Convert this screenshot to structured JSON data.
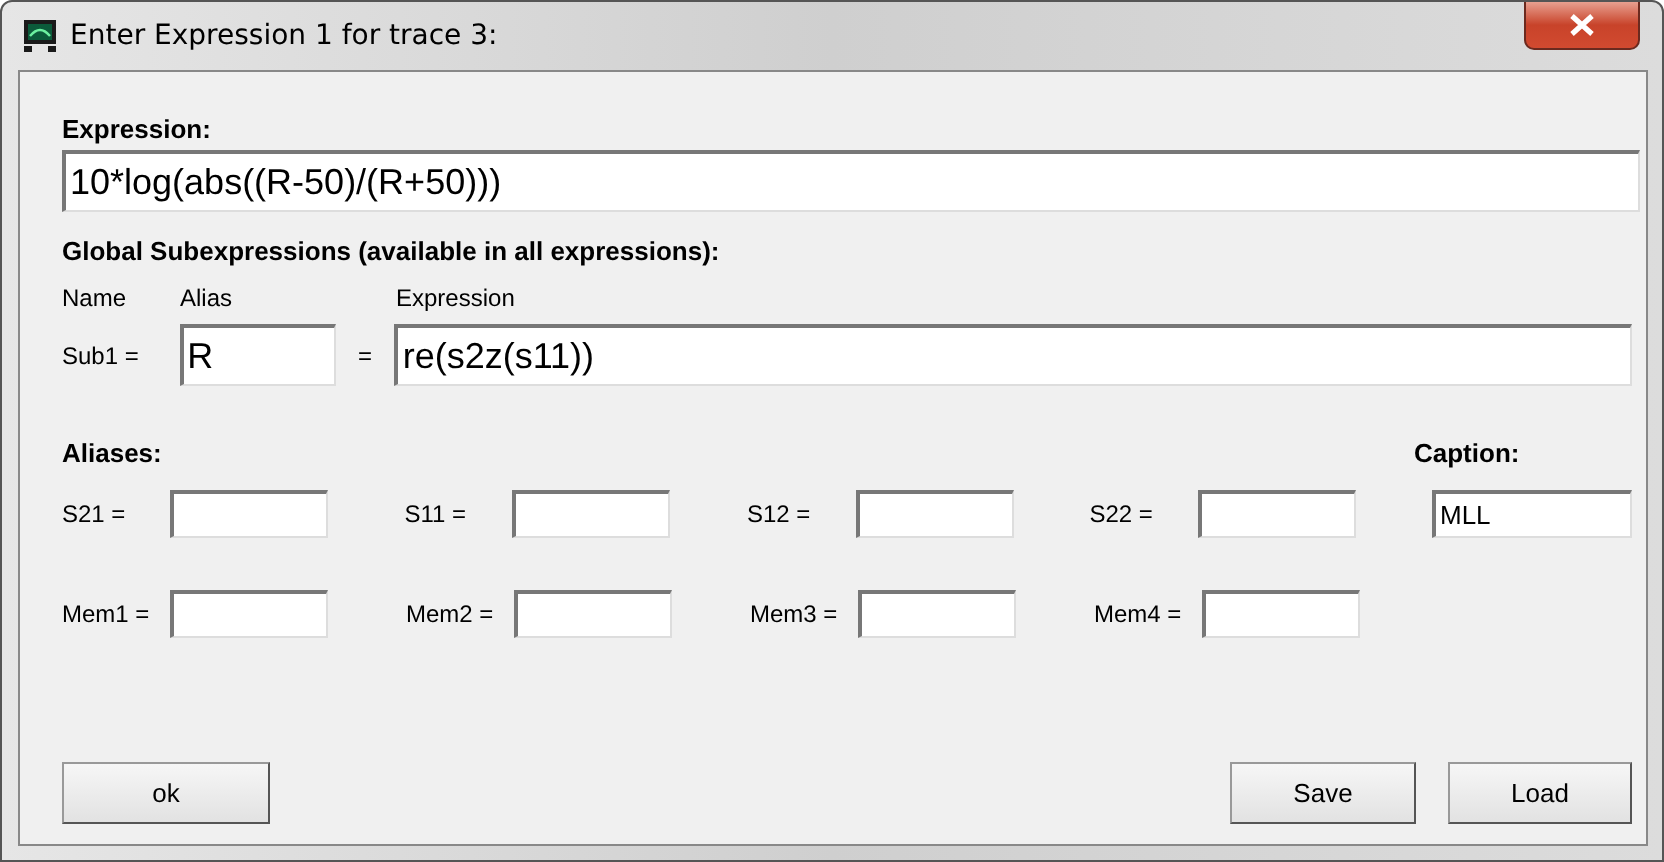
{
  "window": {
    "title": "Enter Expression 1 for trace 3:"
  },
  "expression": {
    "label": "Expression:",
    "value": "10*log(abs((R-50)/(R+50)))"
  },
  "global_subexpressions": {
    "label": "Global Subexpressions (available in all expressions):",
    "headers": [
      "Name",
      "Alias",
      "Expression"
    ],
    "rows": [
      {
        "name": "Sub1 =",
        "alias": "R",
        "equals": "=",
        "expression": "re(s2z(s11))"
      }
    ]
  },
  "aliases": {
    "label": "Aliases:",
    "fields": [
      {
        "label": "S21 ="
      },
      {
        "label": "S11 ="
      },
      {
        "label": "S12 ="
      },
      {
        "label": "S22 ="
      },
      {
        "label": "Mem1 ="
      },
      {
        "label": "Mem2 ="
      },
      {
        "label": "Mem3 ="
      },
      {
        "label": "Mem4 ="
      }
    ]
  },
  "caption": {
    "label": "Caption:",
    "value": "MLL"
  },
  "buttons": [
    {
      "label": "ok",
      "kind": "left"
    },
    {
      "label": "Save",
      "kind": "right"
    },
    {
      "label": "Load",
      "kind": "right"
    }
  ]
}
